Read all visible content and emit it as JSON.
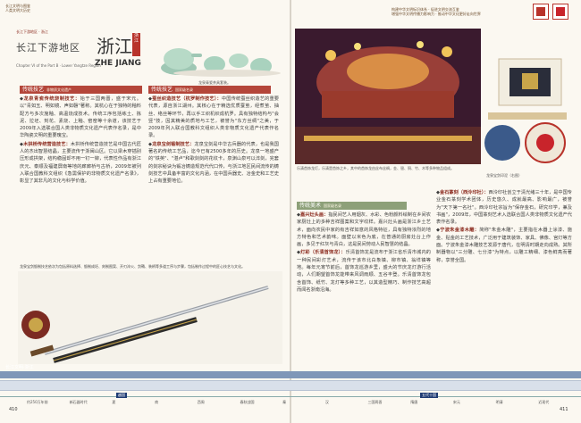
{
  "header": {
    "left_line1": "长江文明与图鉴",
    "left_line2": "人类文明大历史",
    "right_line1": "构建中华文明标识体系 · 促进文明交流互鉴",
    "right_line2": "增强中华文明传播力影响力 · 推动中华文化更好走向世界"
  },
  "title": {
    "kicker": "长江下游地区 · 浙江",
    "region_name": "长江下游地区",
    "province": "浙江",
    "en_chapter": "Chapter VI of the Part B · Lower Yangtze Region",
    "en_province": "ZHE JIANG",
    "region_tag": "浙江"
  },
  "left_section": {
    "heading": "传统技艺",
    "heading_sub": "非物质文化遗产",
    "items": [
      {
        "name": "龙泉青瓷传统烧制技艺：",
        "text": "始于三国两晋，盛于宋元。以\"青如玉、明如镜、声如磬\"著称。其杭心在于独特的釉料配方与多次施釉、高温烧成技术。传统工序包括练土、拣泥、拉坯、刻花、素烧、上釉、窑窑等十余道，该技艺于2009年入选联合国人类非物质文化遗产代表作名录，是中华陶瓷文明的重要瑰宝。"
      },
      {
        "name": "木拱桥传统营造技艺：",
        "text": "木拱桥传统营造技艺是中国古代匠人的杰出智慧结晶，主要流传于浙闽山区。它以梁木穿插别压形成拱架，结构稳固却不用一钉一铆，代表性作品有浙江庆元、泰顺及福建屏南等地的廊廊桥与古桥，2009年被列入联合国教科文组织《急需保护的非物质文化遗产名录》，彰显了其非凡的文化与科学价值。"
      }
    ],
    "img_caption": "龙泉青瓷茶具套装。"
  },
  "mid_section": {
    "heading": "传统技艺",
    "heading_sub": "国家级名录",
    "items": [
      {
        "name": "蚕丝织造技艺（杭罗制作技艺）：",
        "text": "中国传统蚕丝织造艺的重要代表，源自浙江湖州。其核心在于精选优质蚕茧，经煮茧、抽丝、络丝等环节，再以手工织机织成杭罗。具有独特结构与\"会竖\"技，因其精美的质地与工艺，被誉为\"东方丝绸\"之美，于2009年列入联合国教科文组织人类非物质文化遗产代表作名录。"
      },
      {
        "name": "龙泉宝剑锻制技艺：",
        "text": "龙泉宝剑是中华古兵器的代表，也是我国著名的传统工艺品，迄今已有2500多年的历史。龙泉一地盛产的\"铁英\"、\"湛卢\"和歌剑剑的花纹卡，泉渊山泉可以淬剑，完套的剑宗秘诀为锻冶铸造规范代代口传，与浙江地区民间流传的铸剑技艺中具备丰富的文化内涵，在中国兵器史、冶金史和工艺史上占有重要地位。"
      }
    ],
    "note": "龙泉宝剑锻制技艺依次为包括原料选择、锻制成坯、刻制图案、开刃淬火、剑鞘、装柄等多道工序与步骤，包括制作过程中的匠心技艺与文化。"
  },
  "right_section": {
    "img_caption1": "乐清首饰龙灯，乐清是首饰之乡，其中的首饰龙由丝布丝绸，金、银、铜、竹、木等多种物品组成。",
    "img_caption2": "龙泉宝剑印泥（右图）",
    "heading": "传统美术",
    "heading_sub": "国家级名录",
    "items_left": [
      {
        "name": "嘉兴灶头画：",
        "text": "指民间艺人用烟灰、水彩、色粉颜料绘制在乡间农家厨灶上的多种吉祥图案和文字纹样。嘉兴灶头画是浙江乡土艺术，面向农民中家的有吉祥如意的风格特征，具有独特浓烈的地方特色和艺术韵味。面壁以米色为底，在普通的厨房灶台上作画，多见于红灰与青白，这是民间劳动人民智慧的结晶。"
      },
      {
        "name": "灯彩（乐清首饰龙）：",
        "text": "乐清首饰龙是流布于浙江省乐清市城内的一种民间彩灯艺术，流传于该市北白象镇、柳市镇、翁垟镇等地。每年元宵节前后，首饰龙巡游乡里，盛大的节庆龙灯游行活动，人们期望首饰龙能带来风调雨顺、五谷丰登。乐清首饰龙包含首饰、纸竹、龙灯等多种工艺，以其造型精巧、制作技艺高超而闻名浙南沿海。"
      }
    ],
    "items_right": [
      {
        "name": "金石篆刻（西泠印社）：",
        "text": "西泠印社创立于清光绪三十年，是中国专业金石篆刻学术团体，历史悠久、成就最高、影响最广，被誉为\"天下第一名社\"。西泠印社宗旨为\"保存金石，研究印学，兼及书画\"，2009年，中国篆刻艺术入选联合国人类非物质文化遗产代表作名录。"
      },
      {
        "name": "宁波朱金漆木雕：",
        "text": "简称\"朱金木雕\"，主要指在木器上涂漆、施金、贴金的工艺技术，广泛用于建筑装饰、家具、佛像、宫灯等方面。宁波朱金漆木雕技艺发源于唐代，在明清时期走向成熟。其所制器物以\"三分雕、七分漆\"为特点，以雕工精细、漆色鲜亮而著称，享誉全国。"
      }
    ]
  },
  "timeline": {
    "title": "长江文明·浙江",
    "labels": [
      "约250万年前",
      "新石器时代",
      "夏",
      "商",
      "西周",
      "春秋战国",
      "秦",
      "汉",
      "三国两晋",
      "隋唐",
      "宋元",
      "明清",
      "近现代"
    ],
    "chip_left": "越国",
    "chip_right": "五代十国",
    "page_left": "410",
    "page_right": "411"
  }
}
